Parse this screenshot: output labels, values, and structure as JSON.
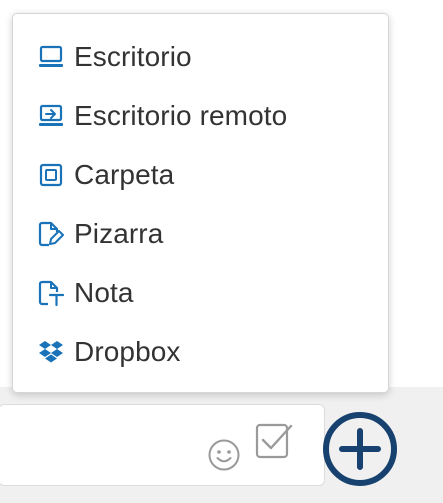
{
  "menu": {
    "items": [
      {
        "label": "Escritorio",
        "icon": "desktop-icon"
      },
      {
        "label": "Escritorio remoto",
        "icon": "remote-desktop-icon"
      },
      {
        "label": "Carpeta",
        "icon": "folder-icon"
      },
      {
        "label": "Pizarra",
        "icon": "whiteboard-icon"
      },
      {
        "label": "Nota",
        "icon": "note-icon"
      },
      {
        "label": "Dropbox",
        "icon": "dropbox-icon"
      }
    ]
  },
  "toolbar": {
    "emoji_icon": "smiley-icon",
    "check_icon": "checkbox-icon",
    "add_icon": "plus-circle-icon"
  },
  "colors": {
    "accent": "#1a73b8",
    "add_button": "#17416e",
    "text": "#333333",
    "icon_gray": "#9a9a9a"
  }
}
